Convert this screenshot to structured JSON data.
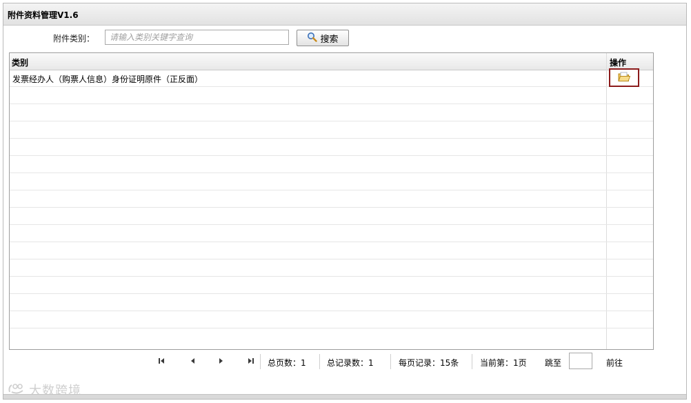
{
  "window": {
    "title": "附件资料管理V1.6"
  },
  "search": {
    "label": "附件类别：",
    "placeholder": "请输入类别关键字查询",
    "button_label": "搜索",
    "button_icon": "search-icon"
  },
  "grid": {
    "columns": [
      "类别",
      "操作"
    ],
    "rows": [
      {
        "category": "发票经办人（购票人信息）身份证明原件（正反面）",
        "action_icon": "open-folder-icon"
      }
    ]
  },
  "pager": {
    "first_icon": "first-page-icon",
    "prev_icon": "prev-page-icon",
    "next_icon": "next-page-icon",
    "last_icon": "last-page-icon",
    "total_pages": "总页数：1",
    "total_records": "总记录数：1",
    "per_page": "每页记录：15条",
    "current_page": "当前第：1页",
    "jump_label": "跳至",
    "go_label": "前往"
  },
  "watermark": {
    "text": "大数跨境"
  },
  "colors": {
    "highlight_border": "#8b1a1a",
    "header_bg": "#e8e8e8"
  }
}
